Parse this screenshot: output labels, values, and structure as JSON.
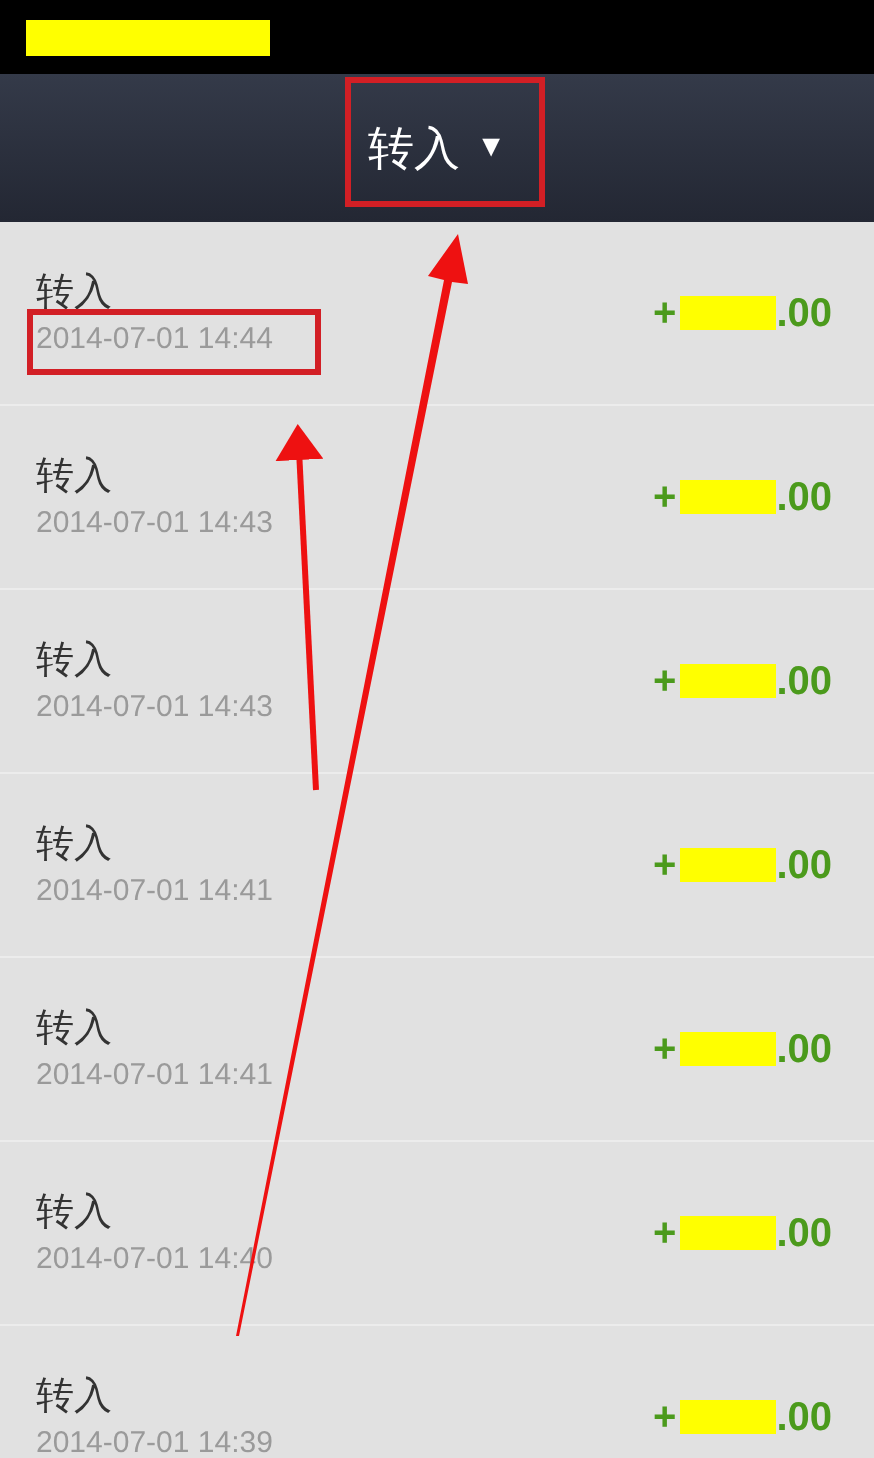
{
  "header": {
    "title": "转入",
    "dropdown_icon": "▼"
  },
  "transactions": [
    {
      "title": "转入",
      "time": "2014-07-01 14:44",
      "amount_prefix": "+",
      "amount_suffix": ".00"
    },
    {
      "title": "转入",
      "time": "2014-07-01 14:43",
      "amount_prefix": "+",
      "amount_suffix": ".00"
    },
    {
      "title": "转入",
      "time": "2014-07-01 14:43",
      "amount_prefix": "+",
      "amount_suffix": ".00"
    },
    {
      "title": "转入",
      "time": "2014-07-01 14:41",
      "amount_prefix": "+",
      "amount_suffix": ".00"
    },
    {
      "title": "转入",
      "time": "2014-07-01 14:41",
      "amount_prefix": "+",
      "amount_suffix": ".00"
    },
    {
      "title": "转入",
      "time": "2014-07-01 14:40",
      "amount_prefix": "+",
      "amount_suffix": ".00"
    },
    {
      "title": "转入",
      "time": "2014-07-01 14:39",
      "amount_prefix": "+",
      "amount_suffix": ".00"
    }
  ]
}
